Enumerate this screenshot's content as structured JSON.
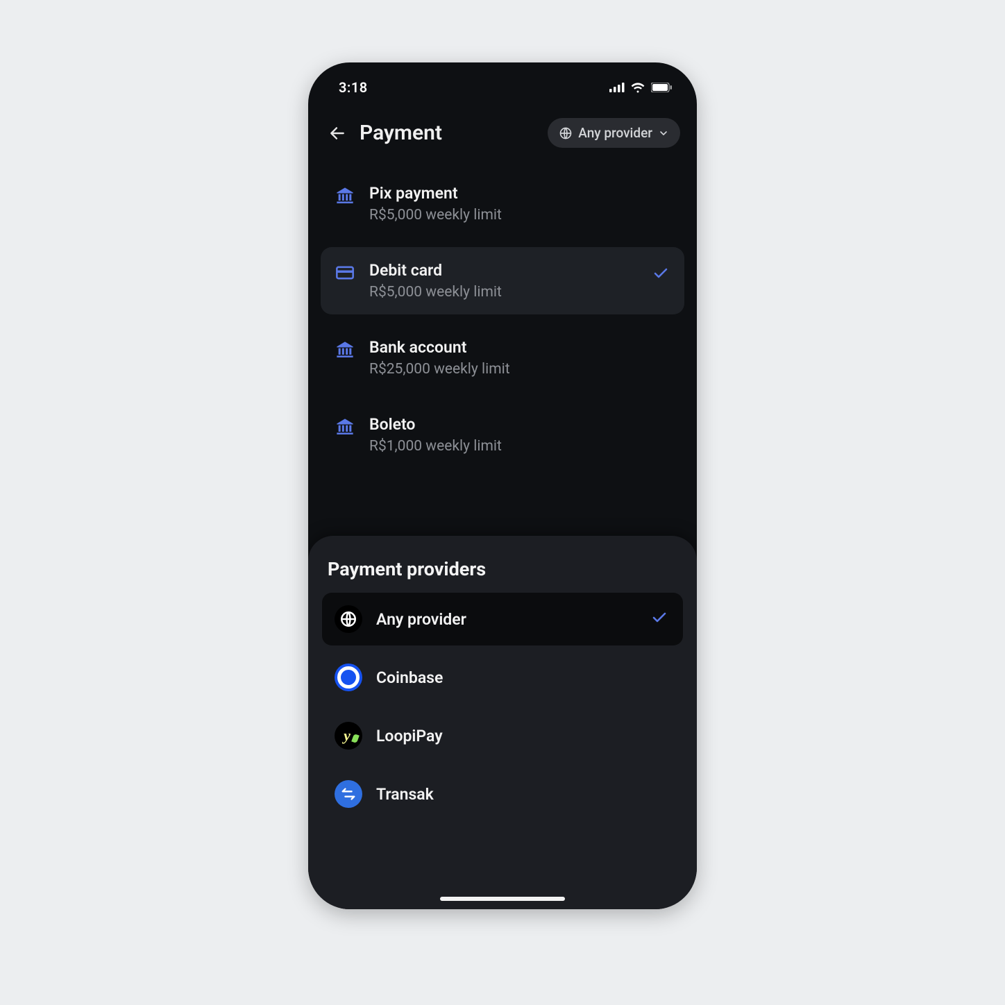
{
  "status": {
    "time": "3:18"
  },
  "header": {
    "title": "Payment",
    "provider_pill_label": "Any provider"
  },
  "payment_methods": [
    {
      "icon": "bank",
      "title": "Pix payment",
      "subtitle": "R$5,000 weekly limit",
      "selected": false
    },
    {
      "icon": "card",
      "title": "Debit card",
      "subtitle": "R$5,000 weekly limit",
      "selected": true
    },
    {
      "icon": "bank",
      "title": "Bank account",
      "subtitle": "R$25,000 weekly limit",
      "selected": false
    },
    {
      "icon": "bank",
      "title": "Boleto",
      "subtitle": "R$1,000 weekly limit",
      "selected": false
    }
  ],
  "sheet": {
    "title": "Payment providers",
    "providers": [
      {
        "icon": "globe",
        "label": "Any provider",
        "selected": true
      },
      {
        "icon": "coinbase",
        "label": "Coinbase",
        "selected": false
      },
      {
        "icon": "loopipay",
        "label": "LoopiPay",
        "selected": false
      },
      {
        "icon": "transak",
        "label": "Transak",
        "selected": false
      }
    ]
  },
  "colors": {
    "accent": "#5a78e6",
    "bg_dark": "#0e1013",
    "sheet_bg": "#1c1e23",
    "pill_bg": "#2a2c31",
    "selected_row": "#1e2126"
  }
}
